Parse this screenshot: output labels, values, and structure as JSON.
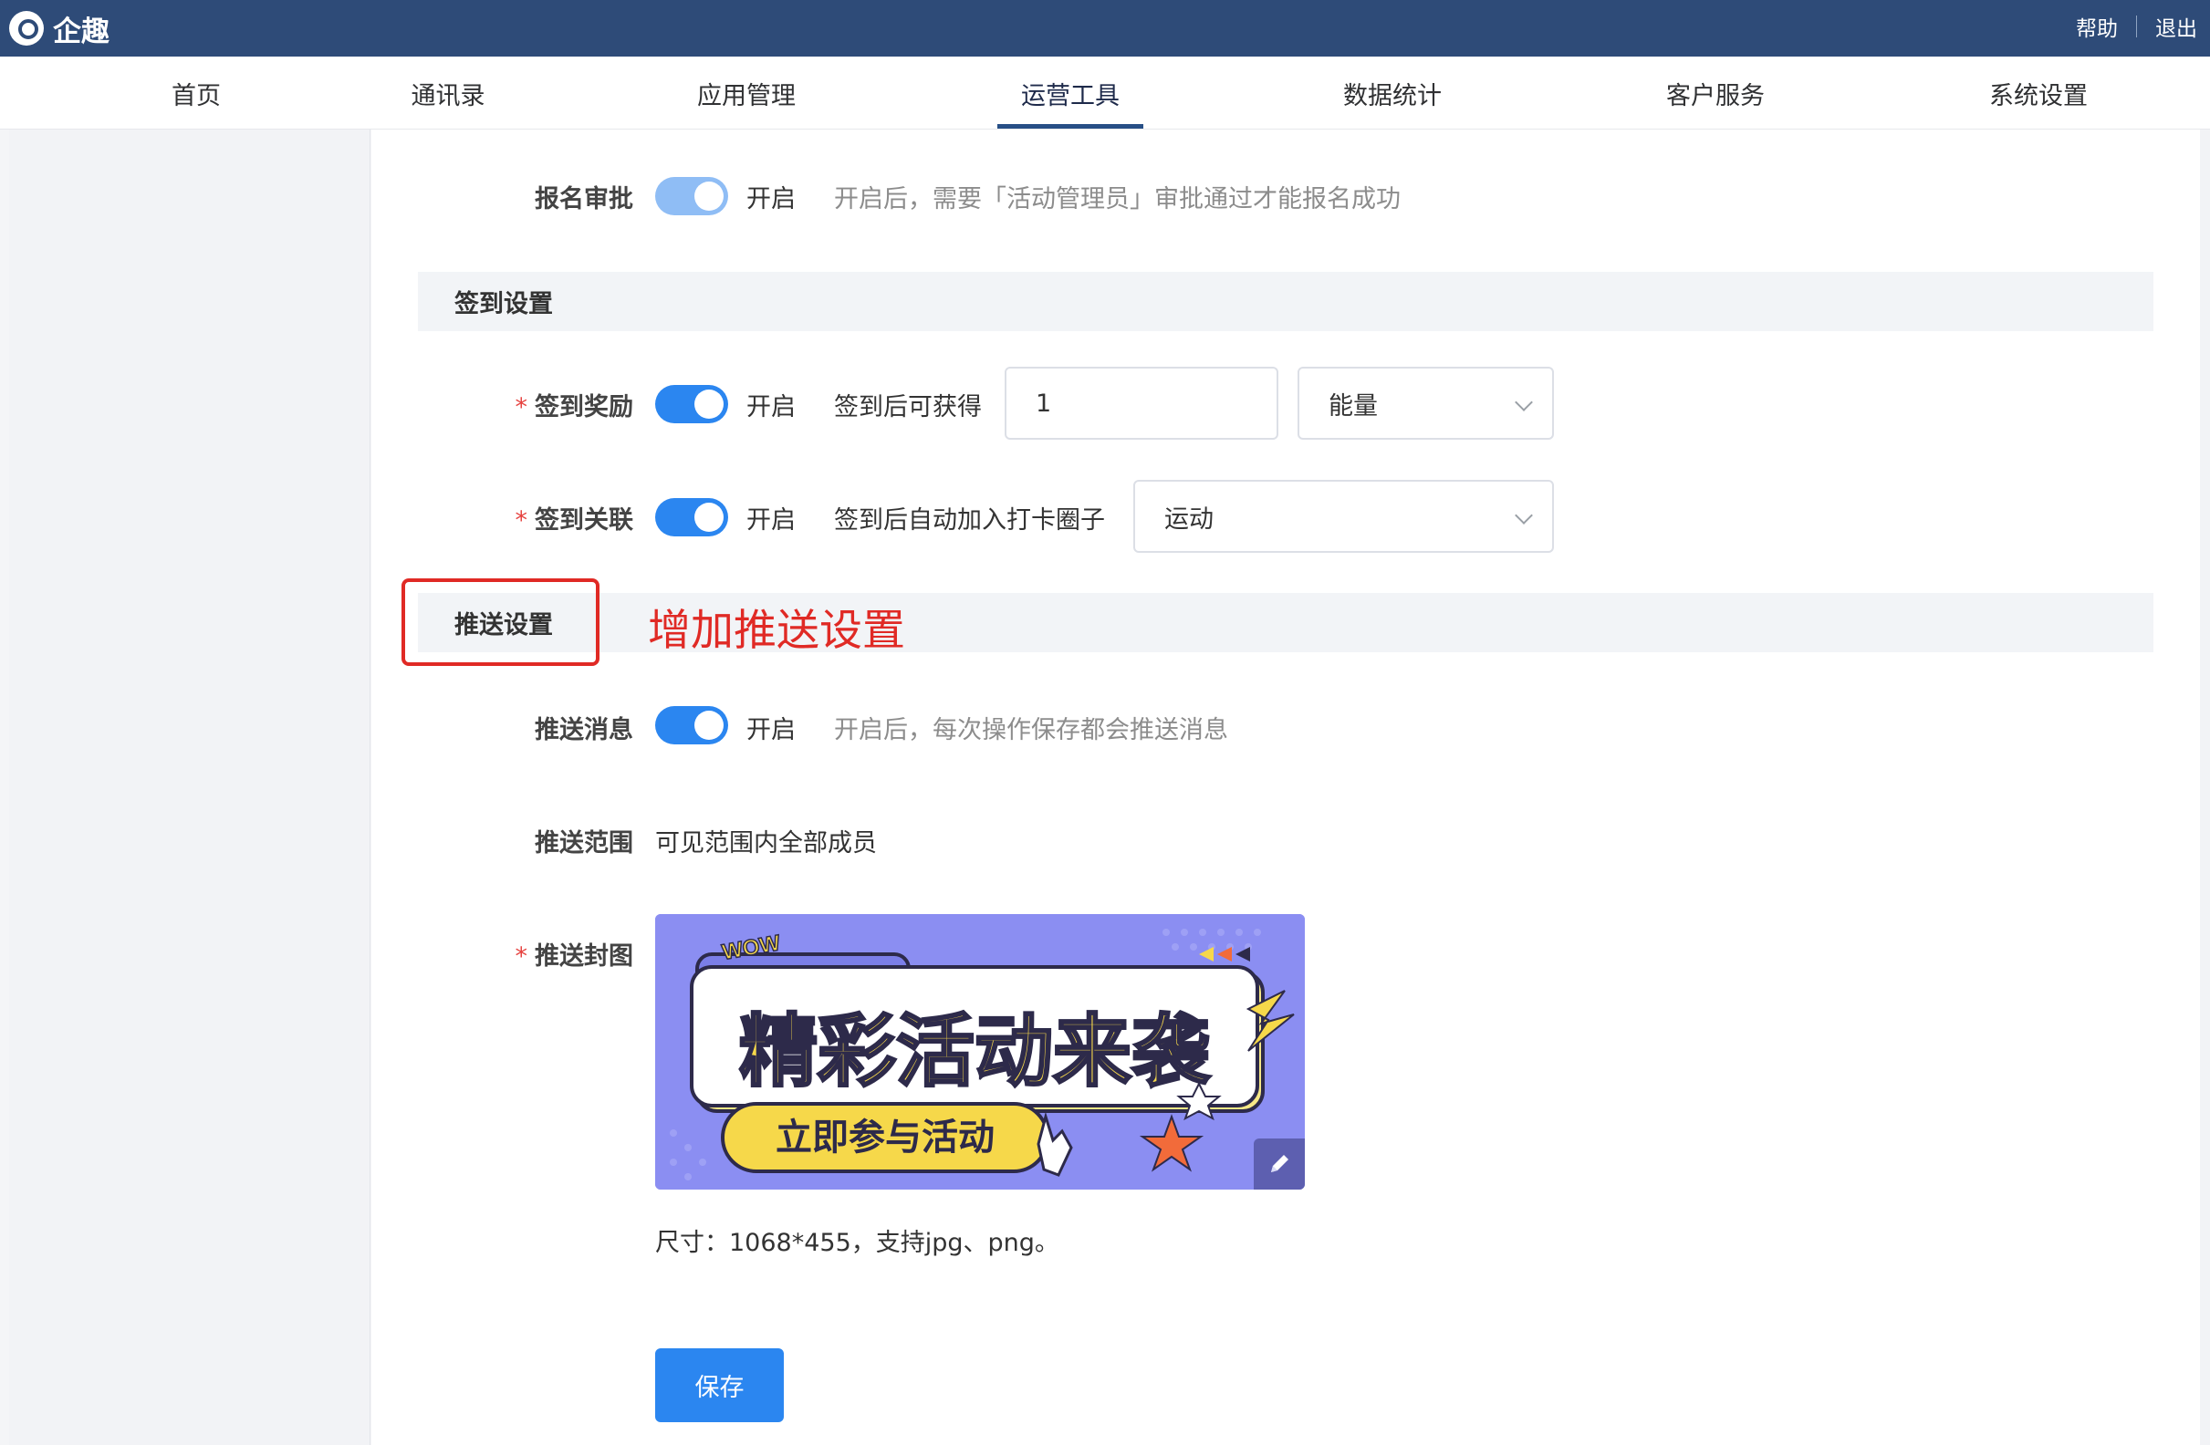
{
  "app": {
    "name": "企趣"
  },
  "header_links": {
    "help": "帮助",
    "logout": "退出"
  },
  "nav": {
    "items": [
      "首页",
      "通讯录",
      "应用管理",
      "运营工具",
      "数据统计",
      "客户服务",
      "系统设置"
    ],
    "active": "运营工具"
  },
  "signup_approval": {
    "label": "报名审批",
    "toggle_text": "开启",
    "hint": "开启后，需要「活动管理员」审批通过才能报名成功"
  },
  "checkin_section": {
    "title": "签到设置"
  },
  "checkin_reward": {
    "label": "签到奖励",
    "toggle_text": "开启",
    "prefix": "签到后可获得",
    "amount": "1",
    "unit": "能量"
  },
  "checkin_link": {
    "label": "签到关联",
    "toggle_text": "开启",
    "prefix": "签到后自动加入打卡圈子",
    "circle": "运动"
  },
  "push_section": {
    "title": "推送设置"
  },
  "annotation": {
    "text": "增加推送设置"
  },
  "push_message": {
    "label": "推送消息",
    "toggle_text": "开启",
    "hint": "开启后，每次操作保存都会推送消息"
  },
  "push_scope": {
    "label": "推送范围",
    "value": "可见范围内全部成员"
  },
  "push_cover": {
    "label": "推送封图",
    "banner_title": "精彩活动来袭",
    "banner_button": "立即参与活动",
    "banner_badge": "WOW",
    "size_hint": "尺寸：1068*455，支持jpg、png。"
  },
  "save_button": {
    "label": "保存"
  },
  "colors": {
    "header_bg": "#2e4b78",
    "primary": "#2b86f0",
    "required": "#e64340",
    "annotation": "#e02a25"
  }
}
